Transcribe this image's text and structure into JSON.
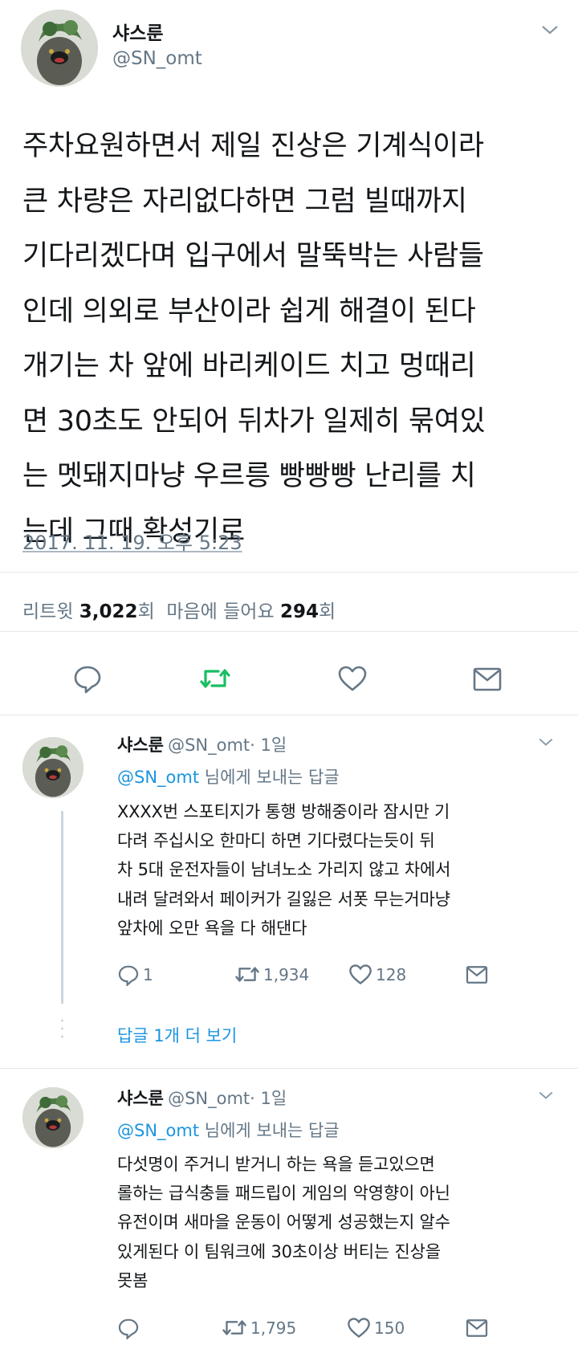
{
  "tweet": {
    "name": "샤스룬",
    "handle": "@SN_omt",
    "text": "주차요원하면서 제일 진상은 기계식이라\n큰 차량은 자리없다하면 그럼 빌때까지\n기다리겠다며 입구에서 말뚝박는 사람들\n인데 의외로 부산이라 쉽게 해결이 된다\n개기는 차 앞에 바리케이드 치고 멍때리\n면 30초도 안되어 뒤차가 일제히 묶여있\n는 멧돼지마냥 우르릉 빵빵빵 난리를 치\n는데 그때 확성기로",
    "timestamp": "2017. 11. 19. 오후 5:23",
    "retweet_label": "리트윗",
    "retweet_count": "3,022",
    "count_suffix_1": "회",
    "like_label": "마음에 들어요",
    "like_count": "294",
    "count_suffix_2": "회",
    "icons": [
      "reply-icon",
      "retweet-icon",
      "like-icon",
      "dm-icon"
    ],
    "retweet_color": "#17bf63"
  },
  "replies": [
    {
      "name": "샤스룬",
      "handle": "@SN_omt",
      "time": "· 1일",
      "reply_to_user": "@SN_omt",
      "reply_to_suffix": "님에게 보내는 답글",
      "text": "XXXX번 스포티지가 통행 방해중이라 잠시만 기\n다려 주십시오 한마디 하면 기다렸다는듯이 뒤\n차 5대 운전자들이 남녀노소 가리지 않고 차에서\n내려 달려와서 페이커가 길잃은 서폿 무는거마냥\n앞차에 오만 욕을 다 해댄다",
      "reply_count": "1",
      "retweet_count": "1,934",
      "like_count": "128",
      "more_replies": "답글 1개 더 보기"
    },
    {
      "name": "샤스룬",
      "handle": "@SN_omt",
      "time": "· 1일",
      "reply_to_user": "@SN_omt",
      "reply_to_suffix": "님에게 보내는 답글",
      "text": "다섯명이 주거니 받거니 하는 욕을 듣고있으면\n롤하는 급식충들 패드립이 게임의 악영향이 아닌\n유전이며 새마을 운동이 어떻게 성공했는지 알수\n있게된다 이 팀워크에 30초이상 버티는 진상을\n못봄",
      "reply_count": "",
      "retweet_count": "1,795",
      "like_count": "150"
    }
  ],
  "colors": {
    "link": "#1b95e0",
    "secondary": "#657786",
    "divider": "#e1e8ed"
  }
}
